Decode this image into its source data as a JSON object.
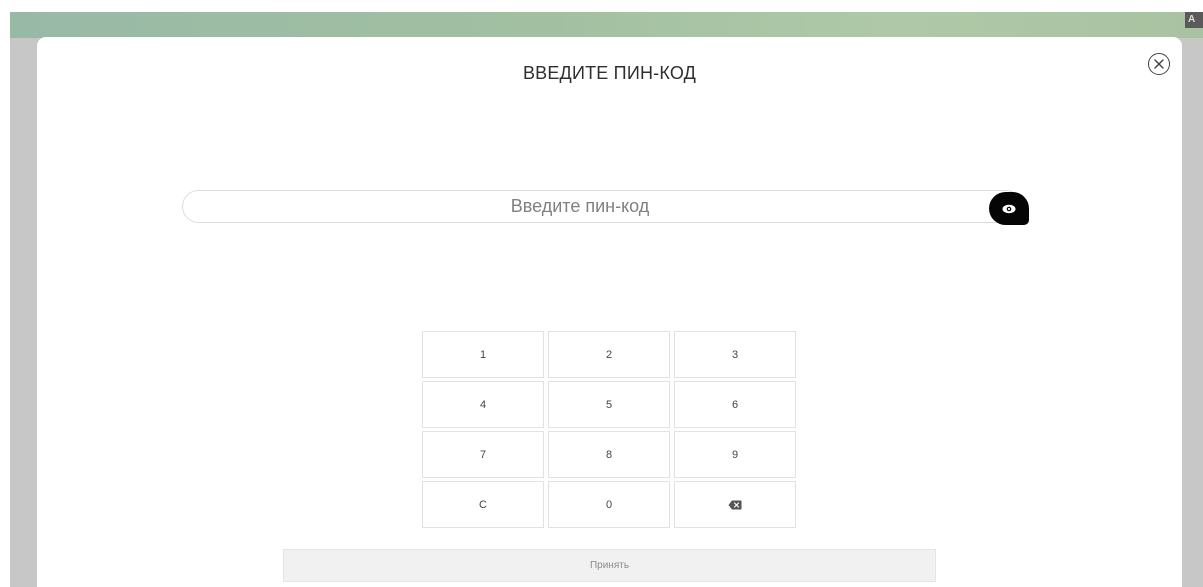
{
  "header": {
    "corner_label": "A",
    "accent_color": "#a2c0a1"
  },
  "modal": {
    "title": "ВВЕДИТЕ ПИН-КОД",
    "close_icon": "close-circle-icon",
    "pin_input": {
      "value": "",
      "placeholder": "Введите пин-код",
      "visibility_icon": "eye-icon"
    },
    "keypad": {
      "keys": [
        {
          "label": "1"
        },
        {
          "label": "2"
        },
        {
          "label": "3"
        },
        {
          "label": "4"
        },
        {
          "label": "5"
        },
        {
          "label": "6"
        },
        {
          "label": "7"
        },
        {
          "label": "8"
        },
        {
          "label": "9"
        },
        {
          "label": "C"
        },
        {
          "label": "0"
        },
        {
          "label": "",
          "icon": "backspace-icon"
        }
      ]
    },
    "accept_label": "Принять"
  }
}
